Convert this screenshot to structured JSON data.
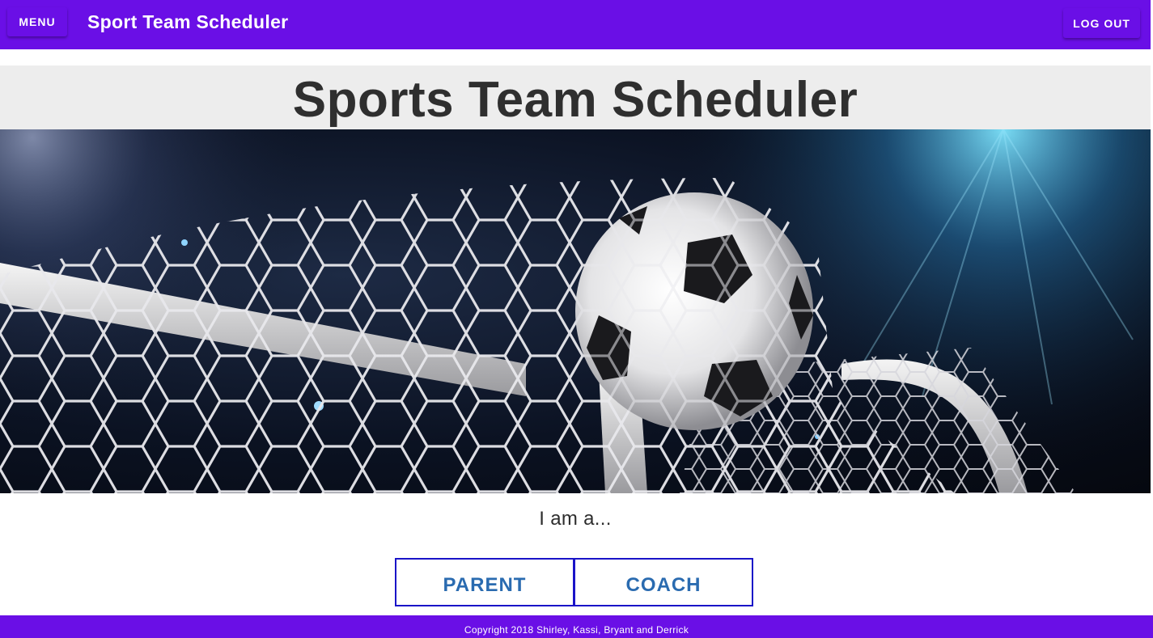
{
  "appbar": {
    "menu_label": "MENU",
    "title": "Sport Team Scheduler",
    "logout_label": "LOG OUT",
    "color": "#6a0fe6"
  },
  "heading": {
    "title": "Sports Team Scheduler"
  },
  "hero": {
    "image": "soccer-ball-in-goal-net"
  },
  "role_select": {
    "prompt": "I am a...",
    "options": [
      "PARENT",
      "COACH"
    ],
    "border_color": "#1a14c8",
    "text_color": "#2a6bb0"
  },
  "footer": {
    "copyright": "Copyright 2018 Shirley, Kassi, Bryant and Derrick"
  }
}
